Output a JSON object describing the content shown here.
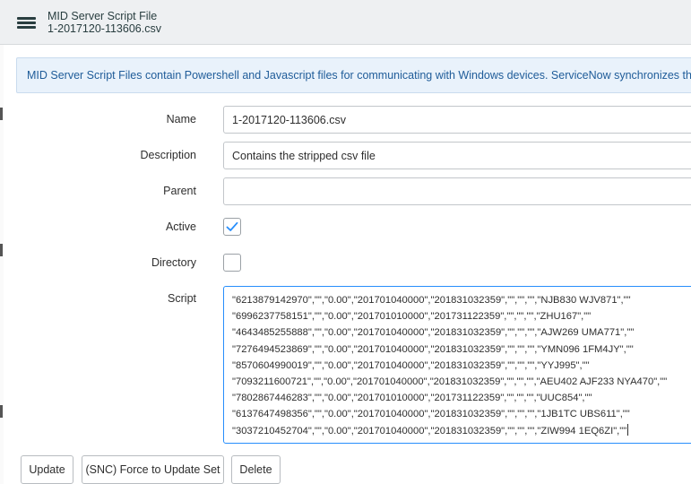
{
  "header": {
    "title": "MID Server Script File",
    "subtitle": "1-2017120-113606.csv",
    "menu_icon": "hamburger-menu-icon"
  },
  "info": {
    "text": "MID Server Script Files contain Powershell and Javascript files for communicating with Windows devices. ServiceNow synchronizes these f"
  },
  "form": {
    "name": {
      "label": "Name",
      "value": "1-2017120-113606.csv"
    },
    "description": {
      "label": "Description",
      "value": "Contains the stripped csv file"
    },
    "parent": {
      "label": "Parent",
      "value": ""
    },
    "active": {
      "label": "Active",
      "checked": true
    },
    "directory": {
      "label": "Directory",
      "checked": false
    },
    "script": {
      "label": "Script",
      "lines": [
        "\"6213879142970\",\"\",\"0.00\",\"201701040000\",\"201831032359\",\"\",\"\",\"\",\"NJB830 WJV871\",\"\"",
        "\"6996237758151\",\"\",\"0.00\",\"201701010000\",\"201731122359\",\"\",\"\",\"\",\"ZHU167\",\"\"",
        "\"4643485255888\",\"\",\"0.00\",\"201701040000\",\"201831032359\",\"\",\"\",\"\",\"AJW269 UMA771\",\"\"",
        "\"7276494523869\",\"\",\"0.00\",\"201701040000\",\"201831032359\",\"\",\"\",\"\",\"YMN096 1FM4JY\",\"\"",
        "\"8570604990019\",\"\",\"0.00\",\"201701040000\",\"201831032359\",\"\",\"\",\"\",\"YYJ995\",\"\"",
        "\"7093211600721\",\"\",\"0.00\",\"201701040000\",\"201831032359\",\"\",\"\",\"\",\"AEU402 AJF233 NYA470\",\"\"",
        "\"7802867446283\",\"\",\"0.00\",\"201701010000\",\"201731122359\",\"\",\"\",\"\",\"UUC854\",\"\"",
        "\"6137647498356\",\"\",\"0.00\",\"201701040000\",\"201831032359\",\"\",\"\",\"\",\"1JB1TC UBS611\",\"\"",
        "\"3037210452704\",\"\",\"0.00\",\"201701040000\",\"201831032359\",\"\",\"\",\"\",\"ZIW994 1EQ6ZI\",\"\""
      ]
    }
  },
  "actions": {
    "update": "Update",
    "force_update": "(SNC) Force to Update Set",
    "delete": "Delete"
  }
}
